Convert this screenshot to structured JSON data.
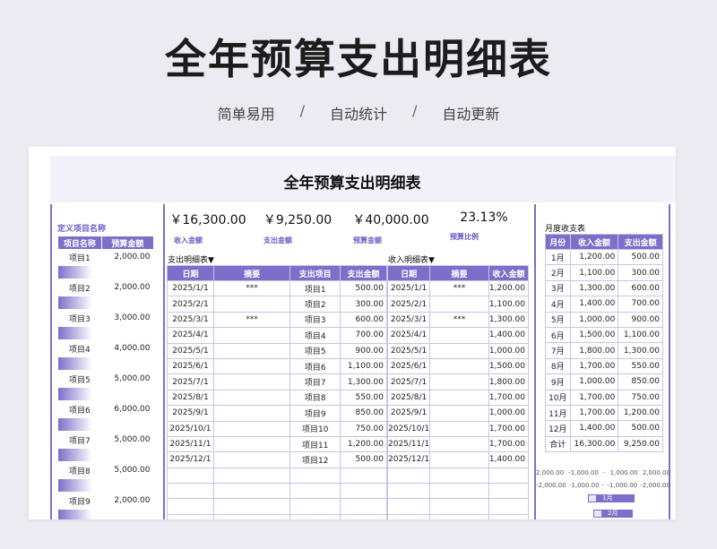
{
  "hero": {
    "title": "全年预算支出明细表",
    "tagline": [
      "简单易用",
      "/",
      "自动统计",
      "/",
      "自动更新"
    ]
  },
  "sheet": {
    "title": "全年预算支出明细表",
    "kpis": [
      {
        "value": "￥16,300.00",
        "label": "收入金额"
      },
      {
        "value": "￥9,250.00",
        "label": "支出金额"
      },
      {
        "value": "￥40,000.00",
        "label": "预算金额"
      },
      {
        "value": "23.13%",
        "label": "预算比例"
      }
    ],
    "left": {
      "label": "定义项目名称",
      "headers": [
        "项目名称",
        "预算金额"
      ],
      "rows": [
        [
          "项目1",
          "2,000.00"
        ],
        [
          "项目2",
          "2,000.00"
        ],
        [
          "项目3",
          "3,000.00"
        ],
        [
          "项目4",
          "4,000.00"
        ],
        [
          "项目5",
          "5,000.00"
        ],
        [
          "项目6",
          "6,000.00"
        ],
        [
          "项目7",
          "5,000.00"
        ],
        [
          "项目8",
          "5,000.00"
        ],
        [
          "项目9",
          "2,000.00"
        ]
      ]
    },
    "expense": {
      "title": "支出明细表▼",
      "headers": [
        "日期",
        "摘要",
        "支出项目",
        "支出金额"
      ],
      "rows": [
        [
          "2025/1/1",
          "***",
          "项目1",
          "500.00"
        ],
        [
          "2025/2/1",
          "",
          "项目2",
          "300.00"
        ],
        [
          "2025/3/1",
          "***",
          "项目3",
          "600.00"
        ],
        [
          "2025/4/1",
          "",
          "项目4",
          "700.00"
        ],
        [
          "2025/5/1",
          "",
          "项目5",
          "900.00"
        ],
        [
          "2025/6/1",
          "",
          "项目6",
          "1,100.00"
        ],
        [
          "2025/7/1",
          "",
          "项目7",
          "1,300.00"
        ],
        [
          "2025/8/1",
          "",
          "项目8",
          "550.00"
        ],
        [
          "2025/9/1",
          "",
          "项目9",
          "850.00"
        ],
        [
          "2025/10/1",
          "",
          "项目10",
          "750.00"
        ],
        [
          "2025/11/1",
          "",
          "项目11",
          "1,200.00"
        ],
        [
          "2025/12/1",
          "",
          "项目12",
          "500.00"
        ],
        [
          "",
          "",
          "",
          ""
        ],
        [
          "",
          "",
          "",
          ""
        ],
        [
          "",
          "",
          "",
          ""
        ],
        [
          "",
          "",
          "",
          ""
        ]
      ]
    },
    "income": {
      "title": "收入明细表▼",
      "headers": [
        "日期",
        "摘要",
        "收入金额"
      ],
      "rows": [
        [
          "2025/1/1",
          "***",
          "1,200.00"
        ],
        [
          "2025/2/1",
          "",
          "1,100.00"
        ],
        [
          "2025/3/1",
          "***",
          "1,300.00"
        ],
        [
          "2025/4/1",
          "",
          "1,400.00"
        ],
        [
          "2025/5/1",
          "",
          "1,000.00"
        ],
        [
          "2025/6/1",
          "",
          "1,500.00"
        ],
        [
          "2025/7/1",
          "",
          "1,800.00"
        ],
        [
          "2025/8/1",
          "",
          "1,700.00"
        ],
        [
          "2025/9/1",
          "",
          "1,000.00"
        ],
        [
          "2025/10/1",
          "",
          "1,700.00"
        ],
        [
          "2025/11/1",
          "",
          "1,700.00"
        ],
        [
          "2025/12/1",
          "",
          "1,400.00"
        ],
        [
          "",
          "",
          ""
        ],
        [
          "",
          "",
          ""
        ],
        [
          "",
          "",
          ""
        ],
        [
          "",
          "",
          ""
        ]
      ]
    },
    "monthly": {
      "title": "月度收支表",
      "headers": [
        "月份",
        "收入金额",
        "支出金额"
      ],
      "rows": [
        [
          "1月",
          "1,200.00",
          "500.00"
        ],
        [
          "2月",
          "1,100.00",
          "300.00"
        ],
        [
          "3月",
          "1,300.00",
          "600.00"
        ],
        [
          "4月",
          "1,400.00",
          "700.00"
        ],
        [
          "5月",
          "1,000.00",
          "900.00"
        ],
        [
          "6月",
          "1,500.00",
          "1,100.00"
        ],
        [
          "7月",
          "1,800.00",
          "1,300.00"
        ],
        [
          "8月",
          "1,700.00",
          "550.00"
        ],
        [
          "9月",
          "1,000.00",
          "850.00"
        ],
        [
          "10月",
          "1,700.00",
          "750.00"
        ],
        [
          "11月",
          "1,700.00",
          "1,200.00"
        ],
        [
          "12月",
          "1,400.00",
          "500.00"
        ],
        [
          "合计",
          "16,300.00",
          "9,250.00"
        ]
      ]
    },
    "chart_axis": [
      "2,000.00",
      "-1,000.00",
      "-",
      "1,000.00",
      "2,000.00"
    ],
    "chart_axis_neg": [
      "-2,000.00",
      "-1,000.00",
      "-",
      "-1,000.00",
      "-2,000.00"
    ],
    "chart_legend": [
      "1月",
      "2月"
    ]
  },
  "colors": {
    "accent": "#7d6fc9",
    "header_bg": "#f3f2fb"
  }
}
